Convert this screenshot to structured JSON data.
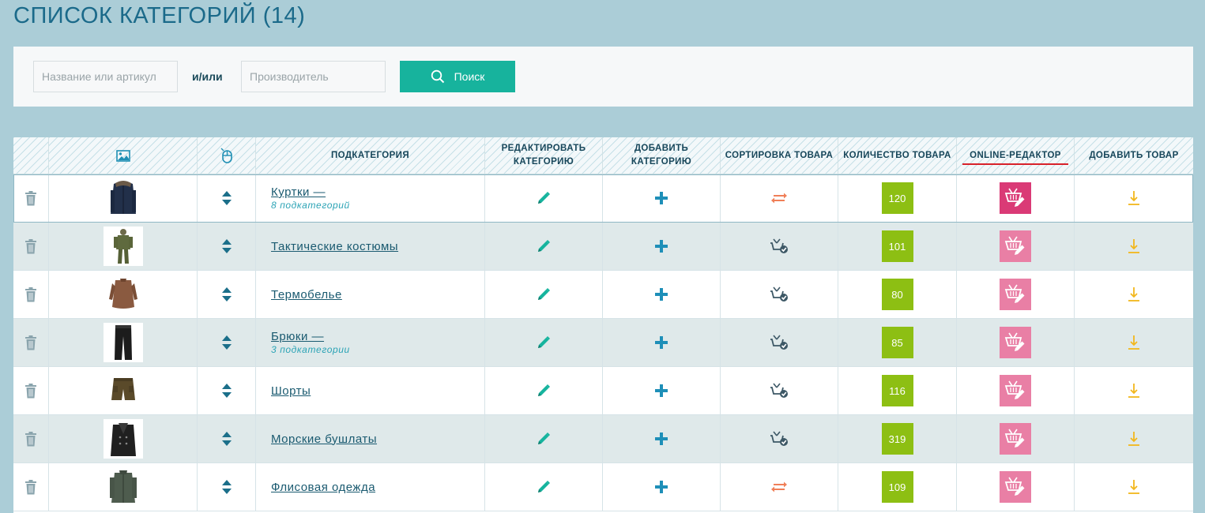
{
  "page": {
    "title": "СПИСОК КАТЕГОРИЙ (14)"
  },
  "search": {
    "name_placeholder": "Название или артикул",
    "or_label": "и/или",
    "maker_placeholder": "Производитель",
    "button_label": "Поиск"
  },
  "table": {
    "headers": {
      "subcategory": "ПОДКАТЕГОРИЯ",
      "edit": "РЕДАКТИРОВАТЬ КАТЕГОРИЮ",
      "add": "ДОБАВИТЬ КАТЕГОРИЮ",
      "sort": "СОРТИРОВКА ТОВАРА",
      "qty": "КОЛИЧЕСТВО ТОВАРА",
      "online": "ONLINE-РЕДАКТОР",
      "add_product": "ДОБАВИТЬ ТОВАР"
    },
    "rows": [
      {
        "name": "Куртки —",
        "sub": "8 подкатегорий",
        "qty": "120",
        "sort_icon": "swap-arrows-icon",
        "online_active": true
      },
      {
        "name": "Тактические костюмы",
        "sub": "",
        "qty": "101",
        "sort_icon": "sort-check-icon",
        "online_active": false
      },
      {
        "name": "Термобелье",
        "sub": "",
        "qty": "80",
        "sort_icon": "sort-check-icon",
        "online_active": false
      },
      {
        "name": "Брюки —",
        "sub": "3 подкатегории",
        "qty": "85",
        "sort_icon": "sort-check-icon",
        "online_active": false
      },
      {
        "name": "Шорты",
        "sub": "",
        "qty": "116",
        "sort_icon": "sort-check-icon",
        "online_active": false
      },
      {
        "name": "Морские бушлаты",
        "sub": "",
        "qty": "319",
        "sort_icon": "sort-check-icon",
        "online_active": false
      },
      {
        "name": "Флисовая одежда",
        "sub": "",
        "qty": "109",
        "sort_icon": "swap-arrows-icon",
        "online_active": false
      }
    ]
  },
  "colors": {
    "background": "#abcdd7",
    "accent_teal": "#17b39d",
    "qty_green": "#8dbf13",
    "online_pink": "#e97fa5",
    "online_pink_active": "#da3a76",
    "add_product_yellow": "#f2b71c",
    "swap_orange": "#f07f58",
    "online_underline": "#d8212a"
  }
}
